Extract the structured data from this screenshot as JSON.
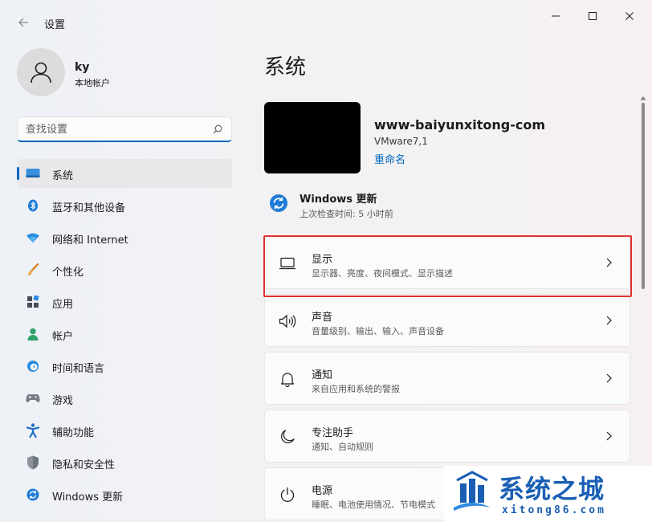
{
  "window": {
    "app_title": "设置",
    "controls": [
      "minimize",
      "maximize",
      "close"
    ]
  },
  "account": {
    "name": "ky",
    "type": "本地帐户"
  },
  "search": {
    "placeholder": "查找设置",
    "value": ""
  },
  "sidebar": {
    "items": [
      {
        "label": "系统",
        "icon": "system-icon",
        "selected": true
      },
      {
        "label": "蓝牙和其他设备",
        "icon": "bluetooth-icon"
      },
      {
        "label": "网络和 Internet",
        "icon": "network-icon"
      },
      {
        "label": "个性化",
        "icon": "brush-icon"
      },
      {
        "label": "应用",
        "icon": "apps-icon"
      },
      {
        "label": "帐户",
        "icon": "account-icon"
      },
      {
        "label": "时间和语言",
        "icon": "time-language-icon"
      },
      {
        "label": "游戏",
        "icon": "gaming-icon"
      },
      {
        "label": "辅助功能",
        "icon": "accessibility-icon"
      },
      {
        "label": "隐私和安全性",
        "icon": "shield-icon"
      },
      {
        "label": "Windows 更新",
        "icon": "windows-update-icon"
      }
    ]
  },
  "main": {
    "title": "系统",
    "device": {
      "name": "www-baiyunxitong-com",
      "model": "VMware7,1",
      "rename": "重命名"
    },
    "update": {
      "title": "Windows 更新",
      "subtitle": "上次检查时间: 5 小时前"
    },
    "cards": [
      {
        "title": "显示",
        "subtitle": "显示器、亮度、夜间模式、显示描述",
        "icon": "display-icon",
        "highlighted": true
      },
      {
        "title": "声音",
        "subtitle": "音量级别、输出、输入、声音设备",
        "icon": "speaker-icon"
      },
      {
        "title": "通知",
        "subtitle": "来自应用和系统的警报",
        "icon": "bell-icon"
      },
      {
        "title": "专注助手",
        "subtitle": "通知、自动规则",
        "icon": "moon-icon"
      },
      {
        "title": "电源",
        "subtitle": "睡眠、电池使用情况、节电模式",
        "icon": "power-icon"
      }
    ]
  },
  "watermark": {
    "title": "系统之城",
    "url": "xitong86.com"
  },
  "colors": {
    "accent": "#0067c0",
    "highlight_border": "#e03131",
    "watermark_blue": "#1a5fb4"
  }
}
